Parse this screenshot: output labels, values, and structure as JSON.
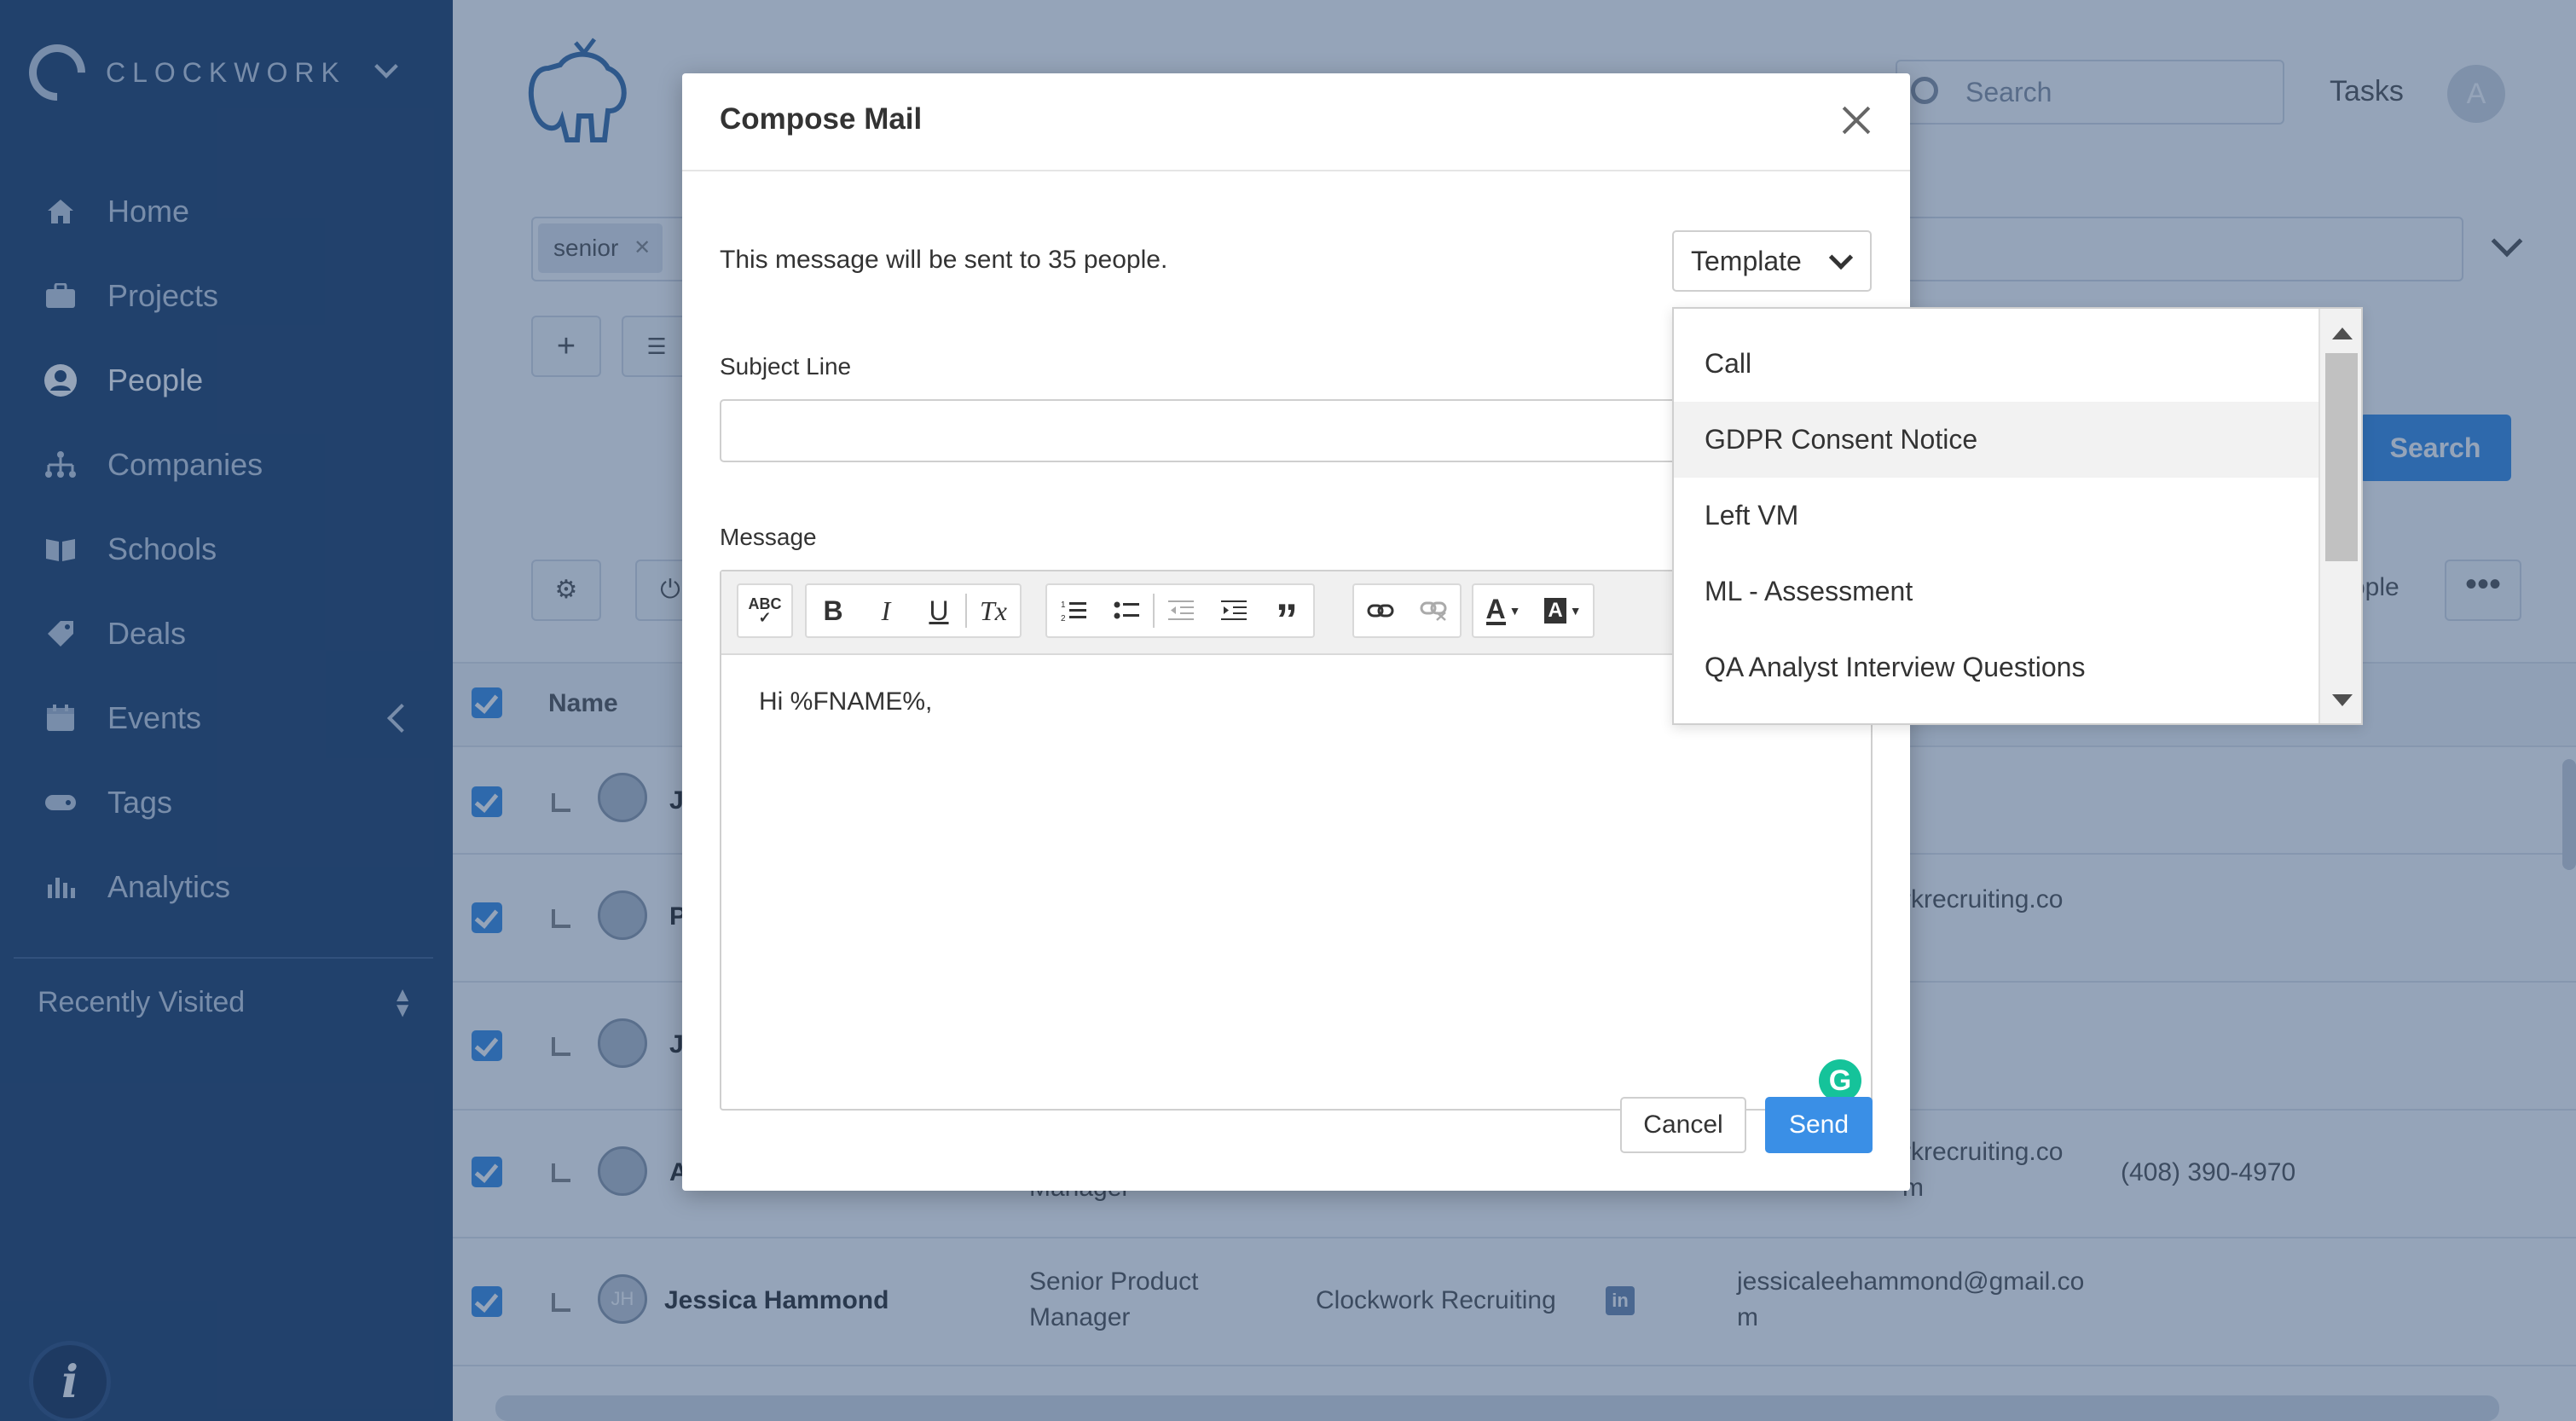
{
  "app": {
    "brand": "CLOCKWORK",
    "colors": {
      "sidebar": "#22416c",
      "accent": "#3a8fe6",
      "overlay": "rgba(34,65,108,0.48)"
    }
  },
  "sidebar": {
    "items": [
      {
        "label": "Home",
        "icon": "home-icon",
        "active": false
      },
      {
        "label": "Projects",
        "icon": "briefcase-icon",
        "active": false
      },
      {
        "label": "People",
        "icon": "person-icon",
        "active": true
      },
      {
        "label": "Companies",
        "icon": "org-chart-icon",
        "active": false
      },
      {
        "label": "Schools",
        "icon": "book-icon",
        "active": false
      },
      {
        "label": "Deals",
        "icon": "tag-icon",
        "active": false
      },
      {
        "label": "Events",
        "icon": "calendar-icon",
        "active": false
      },
      {
        "label": "Tags",
        "icon": "label-icon",
        "active": false
      },
      {
        "label": "Analytics",
        "icon": "bar-chart-icon",
        "active": false
      }
    ],
    "recently_visited": "Recently Visited",
    "info_glyph": "i"
  },
  "header": {
    "search_placeholder": "Search",
    "tasks": "Tasks",
    "avatar_initial": "A"
  },
  "filter": {
    "chip": "senior",
    "search_button": "Search",
    "people_label": "ople",
    "more": "•••"
  },
  "table": {
    "name_header": "Name",
    "rows": [
      {
        "initial": "J",
        "title": "",
        "company": "",
        "email": "",
        "phone": ""
      },
      {
        "initial": "P",
        "title": "",
        "company": "",
        "email": "rkrecruiting.co",
        "phone": ""
      },
      {
        "initial": "J",
        "title": "",
        "company": "",
        "email": "",
        "phone": ""
      },
      {
        "initial": "A",
        "title": "Manager",
        "company": "",
        "email": "rkrecruiting.co\nm",
        "phone": "(408) 390-4970"
      },
      {
        "initial": "Jessica Hammond",
        "avatar": "JH",
        "title": "Senior Product\nManager",
        "company": "Clockwork Recruiting",
        "email": "jessicaleehammond@gmail.co\nm",
        "phone": ""
      }
    ]
  },
  "modal": {
    "title": "Compose Mail",
    "recipients_text": "This message will be sent to 35 people.",
    "template_button": "Template",
    "subject_label": "Subject Line",
    "subject_value": "",
    "message_label": "Message",
    "message_body": "Hi %FNAME%,",
    "cancel": "Cancel",
    "send": "Send",
    "grammarly_glyph": "G",
    "toolbar": {
      "spellcheck": "ABC",
      "bold": "B",
      "italic": "I",
      "underline": "U",
      "clear_format": "Tx",
      "quote": "”",
      "font_color": "A",
      "bg_color": "A"
    }
  },
  "template_dropdown": {
    "options": [
      "Call",
      "GDPR Consent Notice",
      "Left VM",
      "ML - Assessment",
      "QA Analyst Interview Questions"
    ],
    "highlighted": "GDPR Consent Notice"
  }
}
